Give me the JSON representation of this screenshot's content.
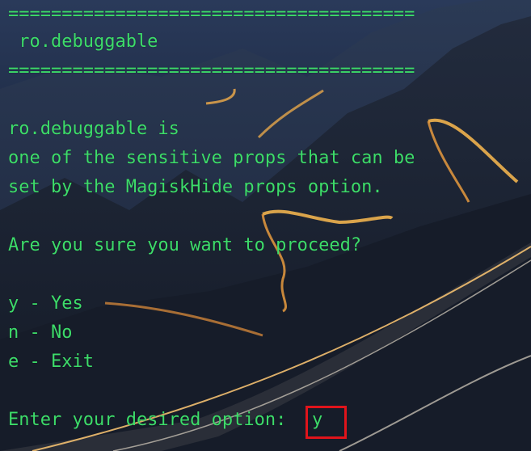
{
  "terminal": {
    "separator_top": "======================================",
    "heading": " ro.debuggable",
    "separator_bottom": "======================================",
    "description": [
      "ro.debuggable is",
      "one of the sensitive props that can be",
      "set by the MagiskHide props option."
    ],
    "question": "Are you sure you want to proceed?",
    "options": [
      "y - Yes",
      "n - No",
      "e - Exit"
    ],
    "prompt": "Enter your desired option: ",
    "input_value": "y"
  },
  "colors": {
    "text": "#3ddc6a",
    "highlight_box": "#e0141b",
    "background": "#0f1522"
  }
}
